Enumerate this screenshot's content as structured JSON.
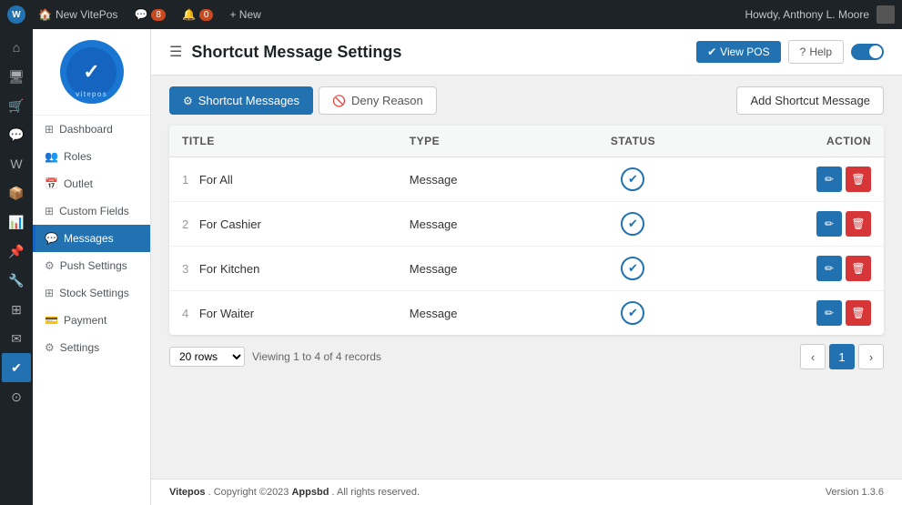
{
  "admin_bar": {
    "site_name": "New VitePos",
    "comments_count": "8",
    "updates_count": "0",
    "new_label": "+ New",
    "howdy": "Howdy, Anthony L. Moore"
  },
  "nav_sidebar": {
    "logo_text": "vitepos",
    "items": [
      {
        "id": "dashboard",
        "label": "Dashboard",
        "icon": "⊞"
      },
      {
        "id": "roles",
        "label": "Roles",
        "icon": "👥"
      },
      {
        "id": "outlet",
        "label": "Outlet",
        "icon": "📅"
      },
      {
        "id": "custom-fields",
        "label": "Custom Fields",
        "icon": "⊞"
      },
      {
        "id": "messages",
        "label": "Messages",
        "icon": "💬",
        "active": true
      },
      {
        "id": "push-settings",
        "label": "Push Settings",
        "icon": "⚙"
      },
      {
        "id": "stock-settings",
        "label": "Stock Settings",
        "icon": "⊞"
      },
      {
        "id": "payment",
        "label": "Payment",
        "icon": "💳"
      },
      {
        "id": "settings",
        "label": "Settings",
        "icon": "⚙"
      }
    ]
  },
  "page": {
    "title": "Shortcut Message Settings",
    "view_pos_label": "View POS",
    "help_label": "Help",
    "tabs": [
      {
        "id": "shortcut-messages",
        "label": "Shortcut Messages",
        "active": true,
        "icon": "⚙"
      },
      {
        "id": "deny-reason",
        "label": "Deny Reason",
        "active": false,
        "icon": "🚫"
      }
    ],
    "add_button_label": "Add Shortcut Message"
  },
  "table": {
    "columns": [
      {
        "id": "title",
        "label": "TITLE"
      },
      {
        "id": "type",
        "label": "TYPE"
      },
      {
        "id": "status",
        "label": "STATUS"
      },
      {
        "id": "action",
        "label": "ACTION"
      }
    ],
    "rows": [
      {
        "num": "1",
        "title": "For All",
        "type": "Message"
      },
      {
        "num": "2",
        "title": "For Cashier",
        "type": "Message"
      },
      {
        "num": "3",
        "title": "For Kitchen",
        "type": "Message"
      },
      {
        "num": "4",
        "title": "For Waiter",
        "type": "Message"
      }
    ]
  },
  "pagination": {
    "rows_label": "20 rows",
    "viewing_label": "Viewing 1 to 4 of 4 records",
    "current_page": "1"
  },
  "footer": {
    "brand": "Vitepos",
    "copyright": ". Copyright ©2023",
    "company": "Appsbd",
    "rights": ". All rights reserved.",
    "version": "Version 1.3.6"
  }
}
